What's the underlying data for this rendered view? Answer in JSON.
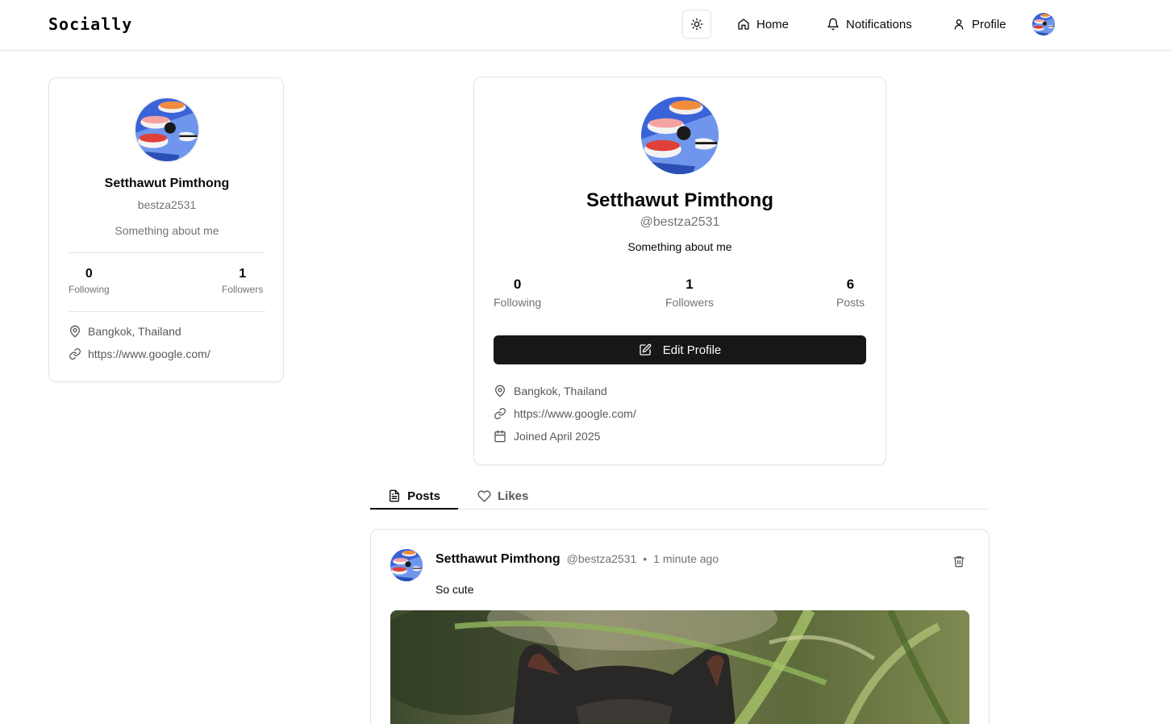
{
  "header": {
    "brand": "Socially",
    "nav": {
      "home_label": "Home",
      "notifications_label": "Notifications",
      "profile_label": "Profile"
    },
    "icons": {
      "theme": "sun-icon",
      "home": "home-icon",
      "notifications": "bell-icon",
      "profile": "user-icon"
    }
  },
  "sidebar": {
    "name": "Setthawut Pimthong",
    "username": "bestza2531",
    "bio": "Something about me",
    "following_count": "0",
    "following_label": "Following",
    "followers_count": "1",
    "followers_label": "Followers",
    "location": "Bangkok, Thailand",
    "website": "https://www.google.com/"
  },
  "profile": {
    "name": "Setthawut Pimthong",
    "username": "@bestza2531",
    "bio": "Something about me",
    "stats": {
      "following_count": "0",
      "following_label": "Following",
      "followers_count": "1",
      "followers_label": "Followers",
      "posts_count": "6",
      "posts_label": "Posts"
    },
    "edit_label": "Edit Profile",
    "location": "Bangkok, Thailand",
    "website": "https://www.google.com/",
    "joined": "Joined April 2025"
  },
  "tabs": {
    "posts_label": "Posts",
    "likes_label": "Likes",
    "active": "Posts"
  },
  "post": {
    "author": "Setthawut Pimthong",
    "handle": "@bestza2531",
    "separator": "•",
    "time": "1 minute ago",
    "text": "So cute"
  },
  "colors": {
    "primary_button": "#171717",
    "border": "#e5e5e5",
    "muted_text": "#737373",
    "avatar_blue": "#3b63d8"
  }
}
